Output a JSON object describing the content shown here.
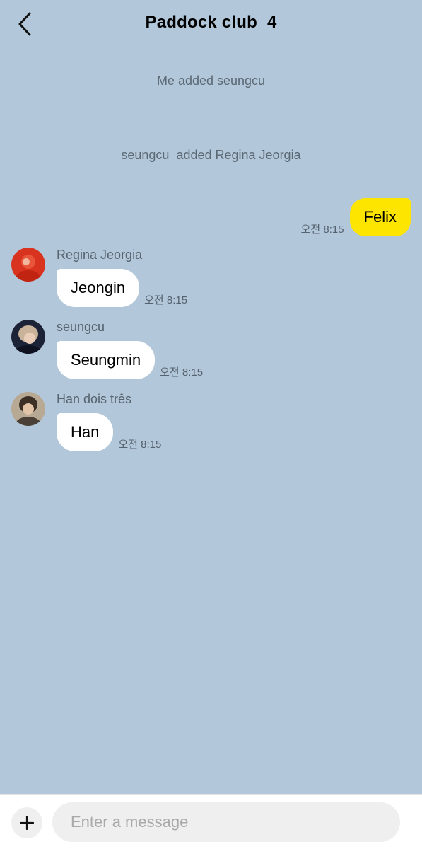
{
  "header": {
    "title": "Paddock club",
    "member_count": "4",
    "back_icon": "chevron-left-icon"
  },
  "system_messages": [
    "Me added seungcu",
    "seungcu  added Regina Jeorgia"
  ],
  "my_message": {
    "text": "Felix",
    "time": "오전 8:15",
    "bubble_color": "#fee500"
  },
  "messages": [
    {
      "sender": "Regina Jeorgia",
      "text": "Jeongin",
      "time": "오전 8:15"
    },
    {
      "sender": "seungcu",
      "text": "Seungmin",
      "time": "오전 8:15"
    },
    {
      "sender": "Han dois três",
      "text": "Han",
      "time": "오전 8:15"
    }
  ],
  "composer": {
    "placeholder": "Enter a message",
    "plus_icon": "plus-icon"
  },
  "colors": {
    "background": "#b2c7d9",
    "other_bubble": "#ffffff",
    "composer_bg": "#efefef"
  }
}
